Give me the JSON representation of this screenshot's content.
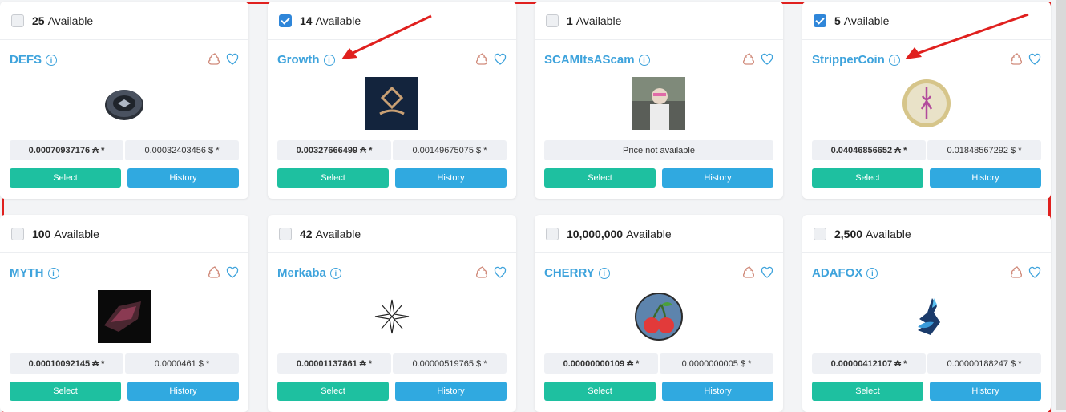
{
  "cards": [
    {
      "available_count": "25",
      "available_label": "Available",
      "checked": false,
      "name": "DEFS",
      "price_ada": "0.00070937176 ₳ *",
      "price_usd": "0.00032403456 $ *",
      "select_label": "Select",
      "history_label": "History",
      "image": "dark-coin-icon"
    },
    {
      "available_count": "14",
      "available_label": "Available",
      "checked": true,
      "name": "Growth",
      "price_ada": "0.00327666499 ₳ *",
      "price_usd": "0.00149675075 $ *",
      "select_label": "Select",
      "history_label": "History",
      "image": "growth-logo-icon"
    },
    {
      "available_count": "1",
      "available_label": "Available",
      "checked": false,
      "name": "SCAMItsAScam",
      "price_text": "Price not available",
      "select_label": "Select",
      "history_label": "History",
      "image": "meme-photo-icon"
    },
    {
      "available_count": "5",
      "available_label": "Available",
      "checked": true,
      "name": "StripperCoin",
      "price_ada": "0.04046856652 ₳ *",
      "price_usd": "0.01848567292 $ *",
      "select_label": "Select",
      "history_label": "History",
      "image": "gold-coin-icon"
    },
    {
      "available_count": "100",
      "available_label": "Available",
      "checked": false,
      "name": "MYTH",
      "price_ada": "0.00010092145 ₳ *",
      "price_usd": "0.0000461 $ *",
      "select_label": "Select",
      "history_label": "History",
      "image": "crystal-rock-icon"
    },
    {
      "available_count": "42",
      "available_label": "Available",
      "checked": false,
      "name": "Merkaba",
      "price_ada": "0.00001137861 ₳ *",
      "price_usd": "0.00000519765 $ *",
      "select_label": "Select",
      "history_label": "History",
      "image": "star-burst-icon"
    },
    {
      "available_count": "10,000,000",
      "available_label": "Available",
      "checked": false,
      "name": "CHERRY",
      "price_ada": "0.00000000109 ₳ *",
      "price_usd": "0.0000000005 $ *",
      "select_label": "Select",
      "history_label": "History",
      "image": "cherry-icon"
    },
    {
      "available_count": "2,500",
      "available_label": "Available",
      "checked": false,
      "name": "ADAFOX",
      "price_ada": "0.00000412107 ₳ *",
      "price_usd": "0.00000188247 $ *",
      "select_label": "Select",
      "history_label": "History",
      "image": "fox-icon"
    }
  ],
  "colors": {
    "accent": "#3ea3dc",
    "select": "#1ec0a0",
    "history": "#30a9e0",
    "annotation": "#e0201e"
  }
}
